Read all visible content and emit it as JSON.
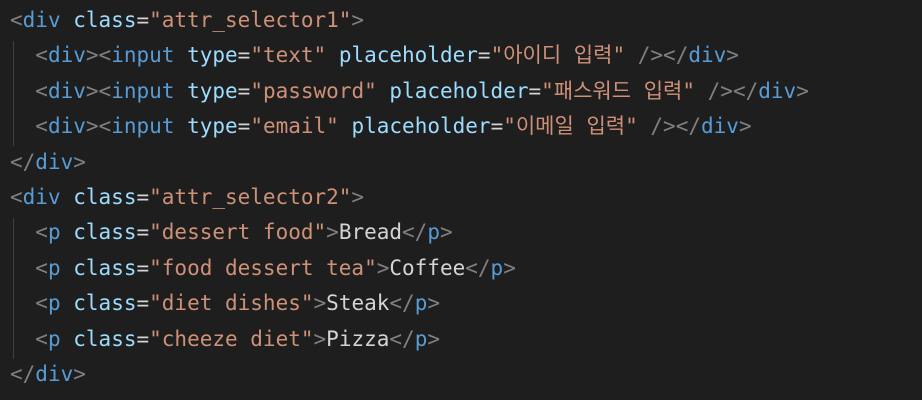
{
  "colors": {
    "background": "#1e1e1e",
    "bracket": "#808080",
    "tag": "#569cd6",
    "attribute": "#9cdcfe",
    "string": "#ce9178",
    "text": "#d4d4d4",
    "indent_guide": "#404040"
  },
  "code_lines": [
    [
      {
        "t": "<",
        "c": "br"
      },
      {
        "t": "div",
        "c": "tg"
      },
      {
        "t": " ",
        "c": "ws"
      },
      {
        "t": "class",
        "c": "at"
      },
      {
        "t": "=",
        "c": "tx"
      },
      {
        "t": "\"attr_selector1\"",
        "c": "st"
      },
      {
        "t": ">",
        "c": "br"
      }
    ],
    [
      {
        "t": "  ",
        "c": "ws"
      },
      {
        "t": "<",
        "c": "br"
      },
      {
        "t": "div",
        "c": "tg"
      },
      {
        "t": ">",
        "c": "br"
      },
      {
        "t": "<",
        "c": "br"
      },
      {
        "t": "input",
        "c": "tg"
      },
      {
        "t": " ",
        "c": "ws"
      },
      {
        "t": "type",
        "c": "at"
      },
      {
        "t": "=",
        "c": "tx"
      },
      {
        "t": "\"text\"",
        "c": "st"
      },
      {
        "t": " ",
        "c": "ws"
      },
      {
        "t": "placeholder",
        "c": "at"
      },
      {
        "t": "=",
        "c": "tx"
      },
      {
        "t": "\"아이디 입력\"",
        "c": "st"
      },
      {
        "t": " ",
        "c": "ws"
      },
      {
        "t": "/>",
        "c": "br"
      },
      {
        "t": "</",
        "c": "br"
      },
      {
        "t": "div",
        "c": "tg"
      },
      {
        "t": ">",
        "c": "br"
      }
    ],
    [
      {
        "t": "  ",
        "c": "ws"
      },
      {
        "t": "<",
        "c": "br"
      },
      {
        "t": "div",
        "c": "tg"
      },
      {
        "t": ">",
        "c": "br"
      },
      {
        "t": "<",
        "c": "br"
      },
      {
        "t": "input",
        "c": "tg"
      },
      {
        "t": " ",
        "c": "ws"
      },
      {
        "t": "type",
        "c": "at"
      },
      {
        "t": "=",
        "c": "tx"
      },
      {
        "t": "\"password\"",
        "c": "st"
      },
      {
        "t": " ",
        "c": "ws"
      },
      {
        "t": "placeholder",
        "c": "at"
      },
      {
        "t": "=",
        "c": "tx"
      },
      {
        "t": "\"패스워드 입력\"",
        "c": "st"
      },
      {
        "t": " ",
        "c": "ws"
      },
      {
        "t": "/>",
        "c": "br"
      },
      {
        "t": "</",
        "c": "br"
      },
      {
        "t": "div",
        "c": "tg"
      },
      {
        "t": ">",
        "c": "br"
      }
    ],
    [
      {
        "t": "  ",
        "c": "ws"
      },
      {
        "t": "<",
        "c": "br"
      },
      {
        "t": "div",
        "c": "tg"
      },
      {
        "t": ">",
        "c": "br"
      },
      {
        "t": "<",
        "c": "br"
      },
      {
        "t": "input",
        "c": "tg"
      },
      {
        "t": " ",
        "c": "ws"
      },
      {
        "t": "type",
        "c": "at"
      },
      {
        "t": "=",
        "c": "tx"
      },
      {
        "t": "\"email\"",
        "c": "st"
      },
      {
        "t": " ",
        "c": "ws"
      },
      {
        "t": "placeholder",
        "c": "at"
      },
      {
        "t": "=",
        "c": "tx"
      },
      {
        "t": "\"이메일 입력\"",
        "c": "st"
      },
      {
        "t": " ",
        "c": "ws"
      },
      {
        "t": "/>",
        "c": "br"
      },
      {
        "t": "</",
        "c": "br"
      },
      {
        "t": "div",
        "c": "tg"
      },
      {
        "t": ">",
        "c": "br"
      }
    ],
    [
      {
        "t": "</",
        "c": "br"
      },
      {
        "t": "div",
        "c": "tg"
      },
      {
        "t": ">",
        "c": "br"
      }
    ],
    [
      {
        "t": "<",
        "c": "br"
      },
      {
        "t": "div",
        "c": "tg"
      },
      {
        "t": " ",
        "c": "ws"
      },
      {
        "t": "class",
        "c": "at"
      },
      {
        "t": "=",
        "c": "tx"
      },
      {
        "t": "\"attr_selector2\"",
        "c": "st"
      },
      {
        "t": ">",
        "c": "br"
      }
    ],
    [
      {
        "t": "  ",
        "c": "ws"
      },
      {
        "t": "<",
        "c": "br"
      },
      {
        "t": "p",
        "c": "tg"
      },
      {
        "t": " ",
        "c": "ws"
      },
      {
        "t": "class",
        "c": "at"
      },
      {
        "t": "=",
        "c": "tx"
      },
      {
        "t": "\"dessert food\"",
        "c": "st"
      },
      {
        "t": ">",
        "c": "br"
      },
      {
        "t": "Bread",
        "c": "tx"
      },
      {
        "t": "</",
        "c": "br"
      },
      {
        "t": "p",
        "c": "tg"
      },
      {
        "t": ">",
        "c": "br"
      }
    ],
    [
      {
        "t": "  ",
        "c": "ws"
      },
      {
        "t": "<",
        "c": "br"
      },
      {
        "t": "p",
        "c": "tg"
      },
      {
        "t": " ",
        "c": "ws"
      },
      {
        "t": "class",
        "c": "at"
      },
      {
        "t": "=",
        "c": "tx"
      },
      {
        "t": "\"food dessert tea\"",
        "c": "st"
      },
      {
        "t": ">",
        "c": "br"
      },
      {
        "t": "Coffee",
        "c": "tx"
      },
      {
        "t": "</",
        "c": "br"
      },
      {
        "t": "p",
        "c": "tg"
      },
      {
        "t": ">",
        "c": "br"
      }
    ],
    [
      {
        "t": "  ",
        "c": "ws"
      },
      {
        "t": "<",
        "c": "br"
      },
      {
        "t": "p",
        "c": "tg"
      },
      {
        "t": " ",
        "c": "ws"
      },
      {
        "t": "class",
        "c": "at"
      },
      {
        "t": "=",
        "c": "tx"
      },
      {
        "t": "\"diet dishes\"",
        "c": "st"
      },
      {
        "t": ">",
        "c": "br"
      },
      {
        "t": "Steak",
        "c": "tx"
      },
      {
        "t": "</",
        "c": "br"
      },
      {
        "t": "p",
        "c": "tg"
      },
      {
        "t": ">",
        "c": "br"
      }
    ],
    [
      {
        "t": "  ",
        "c": "ws"
      },
      {
        "t": "<",
        "c": "br"
      },
      {
        "t": "p",
        "c": "tg"
      },
      {
        "t": " ",
        "c": "ws"
      },
      {
        "t": "class",
        "c": "at"
      },
      {
        "t": "=",
        "c": "tx"
      },
      {
        "t": "\"cheeze diet\"",
        "c": "st"
      },
      {
        "t": ">",
        "c": "br"
      },
      {
        "t": "Pizza",
        "c": "tx"
      },
      {
        "t": "</",
        "c": "br"
      },
      {
        "t": "p",
        "c": "tg"
      },
      {
        "t": ">",
        "c": "br"
      }
    ],
    [
      {
        "t": "</",
        "c": "br"
      },
      {
        "t": "div",
        "c": "tg"
      },
      {
        "t": ">",
        "c": "br"
      }
    ]
  ]
}
